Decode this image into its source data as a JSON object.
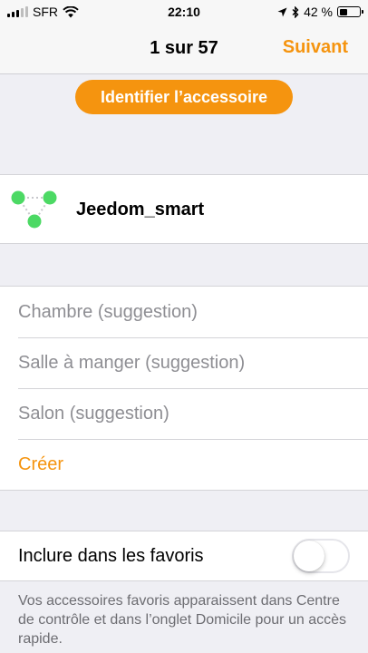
{
  "status_bar": {
    "carrier": "SFR",
    "time": "22:10",
    "battery_text": "42 %",
    "battery_level": 0.42,
    "signal_bars_filled": 3,
    "signal_bars_total": 5,
    "icons": [
      "signal-icon",
      "wifi-icon",
      "location-icon",
      "bluetooth-icon",
      "battery-icon"
    ]
  },
  "nav": {
    "title": "1 sur 57",
    "next_label": "Suivant"
  },
  "identify_button": "Identifier l’accessoire",
  "accessory": {
    "name": "Jeedom_smart",
    "icon": "hub-network-icon"
  },
  "rooms": [
    "Chambre (suggestion)",
    "Salle à manger (suggestion)",
    "Salon (suggestion)"
  ],
  "create_label": "Créer",
  "favorites": {
    "label": "Inclure dans les favoris",
    "enabled": false,
    "note": "Vos accessoires favoris apparaissent dans Centre de contrôle et dans l’onglet Domicile pour un accès rapide."
  },
  "colors": {
    "accent": "#f5940f",
    "background": "#efeff4",
    "node_green": "#4cd964"
  }
}
